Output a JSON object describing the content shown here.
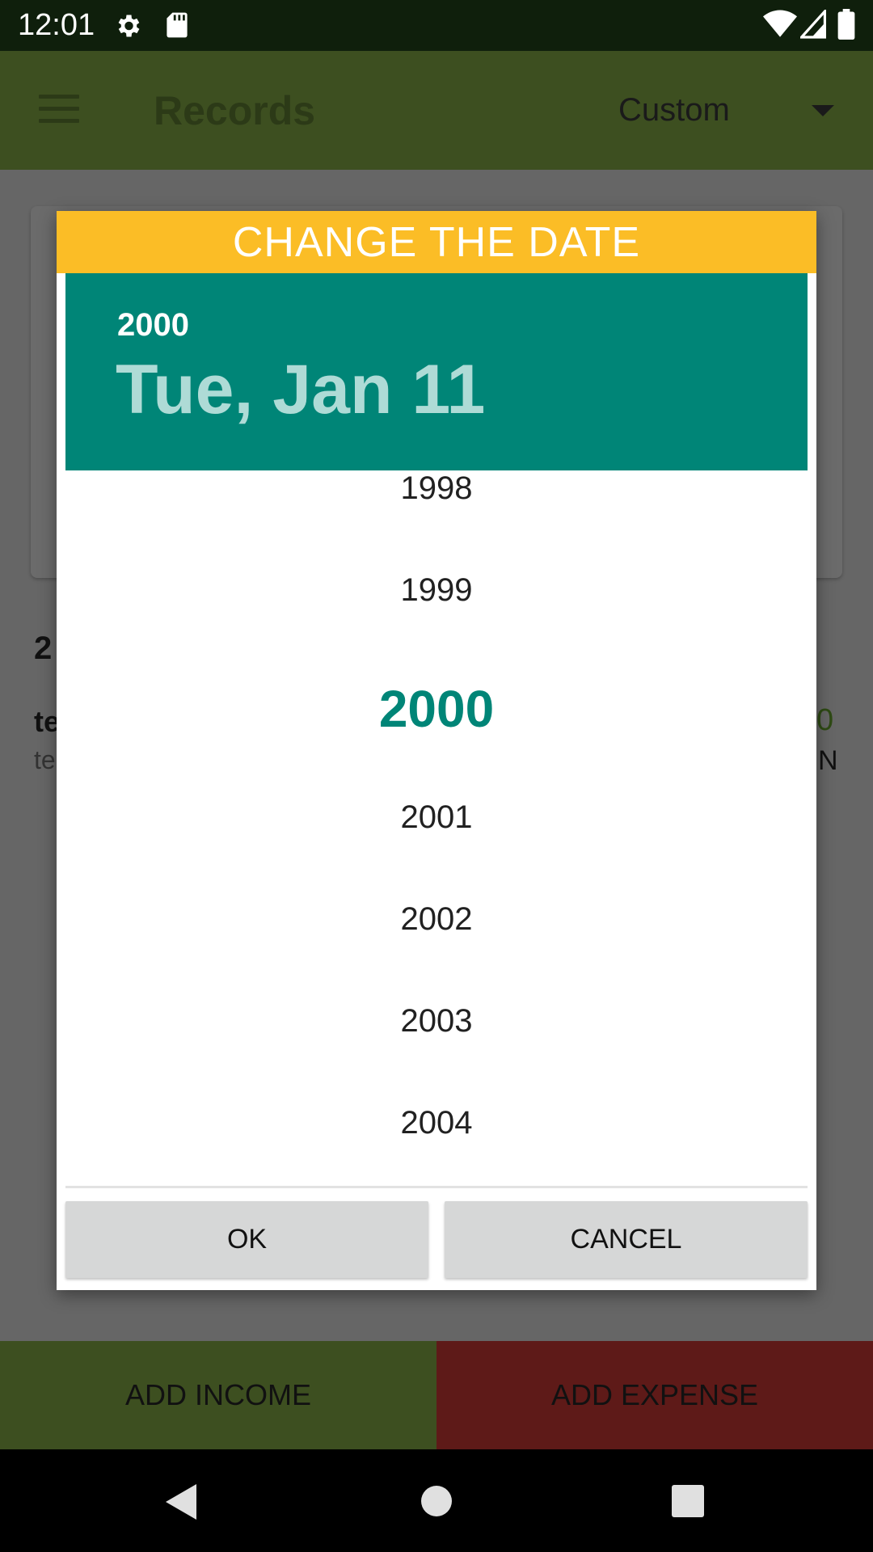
{
  "status_bar": {
    "time": "12:01"
  },
  "app_bar": {
    "title": "Records",
    "filter_value": "Custom"
  },
  "background": {
    "date_partial": "2",
    "entry_title_partial": "te",
    "entry_sub_partial": "te",
    "amount_partial": "0",
    "currency_partial": "N"
  },
  "dialog": {
    "title": "CHANGE THE DATE",
    "header_year": "2000",
    "header_date": "Tue, Jan 11",
    "years": [
      "1998",
      "1999",
      "2000",
      "2001",
      "2002",
      "2003",
      "2004"
    ],
    "selected_year": "2000",
    "ok_label": "OK",
    "cancel_label": "CANCEL"
  },
  "actions": {
    "income_label": "ADD INCOME",
    "expense_label": "ADD EXPENSE"
  },
  "colors": {
    "title_bar": "#fbbd26",
    "header": "#008577",
    "selected_year": "#008577"
  }
}
